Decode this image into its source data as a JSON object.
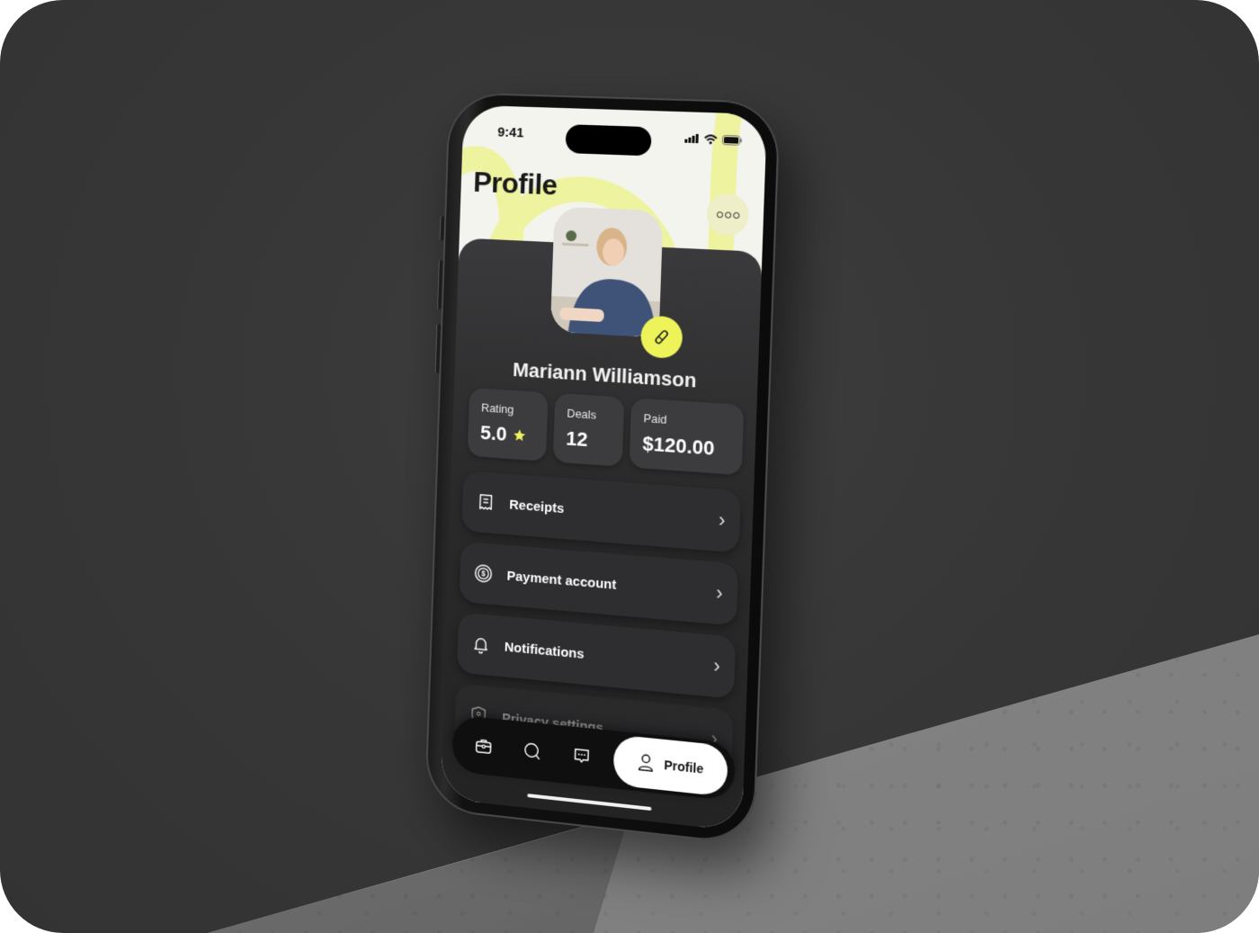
{
  "status_bar": {
    "time": "9:41"
  },
  "header": {
    "title": "Profile",
    "more_icon": "more-horizontal-icon"
  },
  "colors": {
    "accent": "#eef35a",
    "card_bg": "#2b2b2c",
    "screen_top_bg": "#f4f4ef",
    "scene_bg": "#363636"
  },
  "profile": {
    "name": "Mariann Williamson",
    "edit_icon": "pencil-icon"
  },
  "stats": [
    {
      "label": "Rating",
      "value": "5.0",
      "icon": "star-icon"
    },
    {
      "label": "Deals",
      "value": "12"
    },
    {
      "label": "Paid",
      "value": "$120.00"
    }
  ],
  "menu": [
    {
      "label": "Receipts",
      "icon": "receipt-icon"
    },
    {
      "label": "Payment account",
      "icon": "dollar-coin-icon"
    },
    {
      "label": "Notifications",
      "icon": "bell-icon"
    },
    {
      "label": "Privacy settings",
      "icon": "shield-icon"
    }
  ],
  "tabbar": {
    "items": [
      {
        "name": "briefcase",
        "icon": "briefcase-icon"
      },
      {
        "name": "search",
        "icon": "search-icon"
      },
      {
        "name": "messages",
        "icon": "chat-icon"
      }
    ],
    "active": {
      "label": "Profile",
      "icon": "user-icon"
    }
  }
}
